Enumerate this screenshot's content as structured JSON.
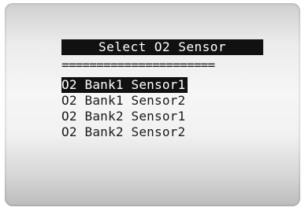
{
  "screen": {
    "title": "Select O2 Sensor",
    "separator": "======================"
  },
  "menu": {
    "selected_index": 0,
    "items": [
      {
        "label": "O2 Bank1 Sensor1"
      },
      {
        "label": "O2 Bank1 Sensor2"
      },
      {
        "label": "O2 Bank2 Sensor1"
      },
      {
        "label": "O2 Bank2 Sensor2"
      }
    ]
  }
}
